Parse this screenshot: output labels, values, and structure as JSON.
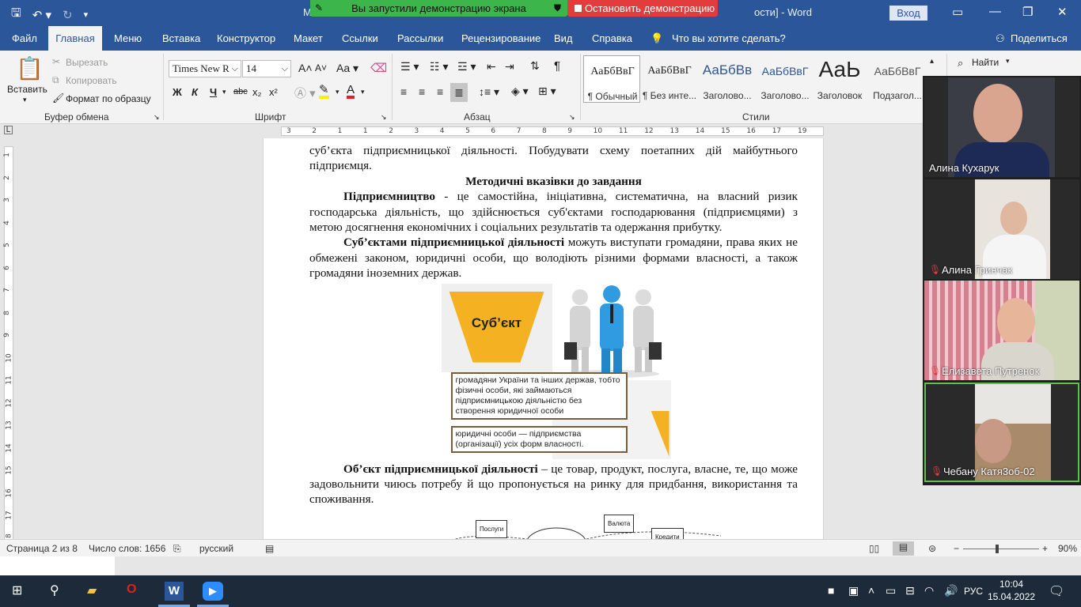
{
  "titlebar": {
    "title_prefix": "М",
    "title_suffix": "ости]",
    "app": "Word",
    "signin": "Вход"
  },
  "sharing": {
    "status": "Вы запустили демонстрацию экрана",
    "stop": "Остановить демонстрацию"
  },
  "menu": {
    "items": [
      "Файл",
      "Главная",
      "Меню",
      "Вставка",
      "Конструктор",
      "Макет",
      "Ссылки",
      "Рассылки",
      "Рецензирование",
      "Вид",
      "Справка"
    ],
    "active": "Главная",
    "tell_me": "Что вы хотите сделать?",
    "share": "Поделиться"
  },
  "ribbon": {
    "clipboard": {
      "paste": "Вставить",
      "cut": "Вырезать",
      "copy": "Копировать",
      "format_painter": "Формат по образцу",
      "label": "Буфер обмена"
    },
    "font": {
      "name": "Times New R",
      "size": "14",
      "label": "Шрифт",
      "bold": "Ж",
      "italic": "К",
      "underline": "Ч",
      "strike": "abc",
      "sub": "x₂",
      "sup": "x²"
    },
    "paragraph": {
      "label": "Абзац"
    },
    "styles": {
      "label": "Стили",
      "items": [
        {
          "sample": "АаБбВвГ",
          "name": "¶ Обычный"
        },
        {
          "sample": "АаБбВвГ",
          "name": "¶ Без инте..."
        },
        {
          "sample": "АаБбВв",
          "name": "Заголово..."
        },
        {
          "sample": "АаБбВвГ",
          "name": "Заголово..."
        },
        {
          "sample": "АаЬ",
          "name": "Заголовок"
        },
        {
          "sample": "АаБбВвГ",
          "name": "Подзагол..."
        }
      ]
    },
    "editing": {
      "find": "Найти"
    }
  },
  "ruler": {
    "marks": [
      "3",
      "2",
      "1",
      "1",
      "2",
      "3",
      "4",
      "5",
      "6",
      "7",
      "8",
      "9",
      "10",
      "11",
      "12",
      "13",
      "14",
      "15",
      "16",
      "17",
      "19"
    ]
  },
  "vruler": {
    "marks": [
      "1",
      "2",
      "3",
      "4",
      "5",
      "6",
      "7",
      "8",
      "9",
      "10",
      "11",
      "12",
      "13",
      "14",
      "15",
      "16",
      "17",
      "18"
    ]
  },
  "document": {
    "p1": "суб’єкта підприємницької діяльності. Побудувати схему поетапних дій майбутнього підприємця.",
    "heading": "Методичні вказівки до завдання",
    "p2_bold": "Підприємництво",
    "p2": " - це самостійна, ініціативна, систематична, на власний ризик господарська діяльність, що здійснюється суб'єктами господарювання (підприємцями) з метою досягнення економічних і соціальних результатів та одержання прибутку.",
    "p3_bold": "Суб’єктами підприємницької діяльності",
    "p3": " можуть виступати громадяни, права яких не обмежені законом, юридичні особи, що володіють різними формами власності, а також громадяни іноземних держав.",
    "figure": {
      "title": "Суб’єкт",
      "box1": "громадяни України та інших держав, тобто фізичні особи, які займаються підприємницькою діяльністю без створення юридичної особи",
      "box2": "юридичні особи — підприємства (організації) усіх форм власності."
    },
    "p4_bold": "Об’єкт підприємницької діяльності",
    "p4": " – це товар, продукт, послуга, власне, те, що може задовольнити чиюсь потребу й що пропонується на ринку для придбання, використання та споживання.",
    "diagram": {
      "left": "Послуги",
      "right": "Валюта",
      "right2": "Кредити"
    }
  },
  "statusbar": {
    "page": "Страница 2 из 8",
    "words": "Число слов: 1656",
    "language": "русский",
    "zoom": "90%",
    "zoom_level": 0.9
  },
  "taskbar": {
    "lang": "РУС",
    "time": "10:04",
    "date": "15.04.2022"
  },
  "participants": [
    {
      "name": "Алина Кухарук",
      "muted": false
    },
    {
      "name": "Алина Гринчак",
      "muted": true
    },
    {
      "name": "Елизавета Путренок",
      "muted": true
    },
    {
      "name": "Чебану Катя3об-02",
      "muted": true
    }
  ],
  "colors": {
    "word_blue": "#2b579a",
    "zoom_green": "#3cb54a",
    "zoom_red": "#e23c3c",
    "figure_yellow": "#f4b223"
  }
}
